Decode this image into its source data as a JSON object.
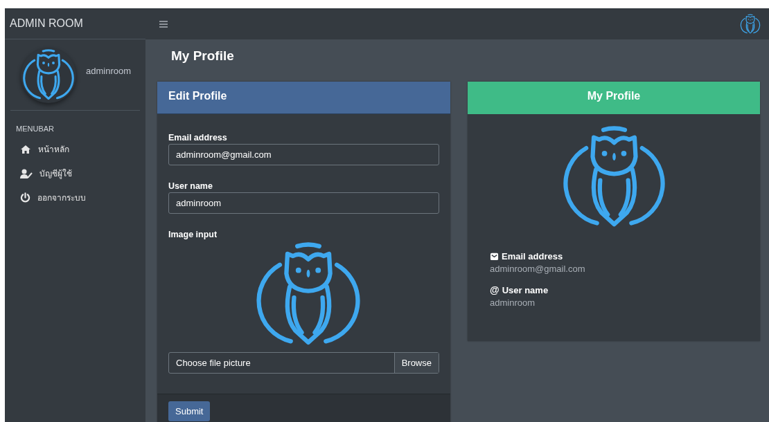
{
  "sidebar": {
    "brand": "ADMIN ROOM",
    "user": {
      "name": "adminroom"
    },
    "menu_heading": "MENUBAR",
    "items": [
      {
        "label": "หน้าหลัก"
      },
      {
        "label": "บัญชีผู้ใช้"
      },
      {
        "label": "ออกจากระบบ"
      }
    ]
  },
  "page_title": "My Profile",
  "edit_profile": {
    "title": "Edit Profile",
    "fields": [
      {
        "label": "Email address",
        "value": "adminroom@gmail.com"
      },
      {
        "label": "User name",
        "value": "adminroom"
      }
    ],
    "image_label": "Image input",
    "file": {
      "placeholder": "Choose file picture",
      "button": "Browse"
    },
    "submit": "Submit"
  },
  "profile_card": {
    "title": "My Profile",
    "details": [
      {
        "label": "Email address",
        "value": "adminroom@gmail.com"
      },
      {
        "glyph": "@",
        "label": "User name",
        "value": "adminroom"
      }
    ]
  }
}
